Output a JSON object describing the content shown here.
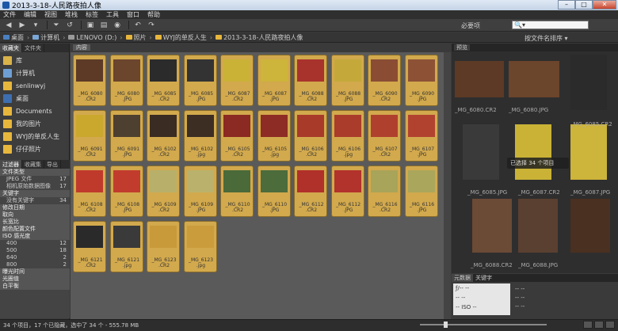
{
  "window": {
    "title": "2013-3-18-人民路夜拍人像",
    "min": "–",
    "max": "□",
    "close": "✕"
  },
  "menu": [
    "文件",
    "编辑",
    "视图",
    "堆栈",
    "标签",
    "工具",
    "窗口",
    "帮助"
  ],
  "toolbar": {
    "workspace": "必要项",
    "search_placeholder": "🔍▾",
    "sort_label": "按文件名排序 ▾"
  },
  "path": [
    "桌面",
    "计算机",
    "LENOVO (D:)",
    "照片",
    "WYJ的单反人生",
    "2013-3-18-人民路夜拍人像"
  ],
  "left": {
    "tabs": [
      "收藏夹",
      "文件夹"
    ],
    "favorites": [
      "库",
      "计算机",
      "senlinwyj",
      "桌面",
      "Documents",
      "我的图片",
      "WYJ的单反人生",
      "仔仔照片"
    ],
    "filter_tabs": [
      "过滤器",
      "收藏集",
      "导出"
    ],
    "filters": [
      {
        "label": "文件类型",
        "count": "",
        "type": "header"
      },
      {
        "label": "JPEG 文件",
        "count": "17",
        "type": "sub"
      },
      {
        "label": "相机原始数据图像",
        "count": "17",
        "type": "sub"
      },
      {
        "label": "关键字",
        "count": "",
        "type": "header"
      },
      {
        "label": "没有关键字",
        "count": "34",
        "type": "sub"
      },
      {
        "label": "修改日期",
        "count": "",
        "type": "header"
      },
      {
        "label": "取向",
        "count": "",
        "type": "header"
      },
      {
        "label": "长宽比",
        "count": "",
        "type": "header"
      },
      {
        "label": "颜色配置文件",
        "count": "",
        "type": "header"
      },
      {
        "label": "ISO 感光度",
        "count": "",
        "type": "header"
      },
      {
        "label": "400",
        "count": "12",
        "type": "sub"
      },
      {
        "label": "500",
        "count": "18",
        "type": "sub"
      },
      {
        "label": "640",
        "count": "2",
        "type": "sub"
      },
      {
        "label": "800",
        "count": "2",
        "type": "sub"
      },
      {
        "label": "曝光时间",
        "count": "",
        "type": "header"
      },
      {
        "label": "光圈值",
        "count": "",
        "type": "header"
      },
      {
        "label": "白平衡",
        "count": "",
        "type": "header"
      }
    ]
  },
  "content": {
    "tab": "内容",
    "thumbs": [
      {
        "name": "_MG_6080",
        "ext": ".CR2",
        "color": "#5c3a26"
      },
      {
        "name": "_MG_6080",
        "ext": ".JPG",
        "color": "#6b452c"
      },
      {
        "name": "_MG_6085",
        "ext": ".CR2",
        "color": "#2b2b2b"
      },
      {
        "name": "_MG_6085",
        "ext": ".JPG",
        "color": "#333333"
      },
      {
        "name": "_MG_6087",
        "ext": ".CR2",
        "color": "#c9b236"
      },
      {
        "name": "_MG_6087",
        "ext": ".JPG",
        "color": "#cdb43a"
      },
      {
        "name": "_MG_6088",
        "ext": ".CR2",
        "color": "#a8332c"
      },
      {
        "name": "_MG_6088",
        "ext": ".JPG",
        "color": "#c4a93a"
      },
      {
        "name": "_MG_6090",
        "ext": ".CR2",
        "color": "#8a4d33"
      },
      {
        "name": "_MG_6090",
        "ext": ".JPG",
        "color": "#8d5236"
      },
      {
        "name": "_MG_6091",
        "ext": ".CR2",
        "color": "#caa82e"
      },
      {
        "name": "_MG_6091",
        "ext": ".JPG",
        "color": "#4d4030"
      },
      {
        "name": "_MG_6102",
        "ext": ".CR2",
        "color": "#3a2c22"
      },
      {
        "name": "_MG_6102",
        "ext": ".jpg",
        "color": "#3d2e24"
      },
      {
        "name": "_MG_6105",
        "ext": ".CR2",
        "color": "#8a2a22"
      },
      {
        "name": "_MG_6105",
        "ext": ".jpg",
        "color": "#8d2c24"
      },
      {
        "name": "_MG_6106",
        "ext": ".CR2",
        "color": "#a83a2a"
      },
      {
        "name": "_MG_6106",
        "ext": ".jpg",
        "color": "#aa3c2c"
      },
      {
        "name": "_MG_6107",
        "ext": ".CR2",
        "color": "#b0402e"
      },
      {
        "name": "_MG_6107",
        "ext": ".JPG",
        "color": "#b24230"
      },
      {
        "name": "_MG_6108",
        "ext": ".CR2",
        "color": "#c03a2c"
      },
      {
        "name": "_MG_6108",
        "ext": ".JPG",
        "color": "#c23c2e"
      },
      {
        "name": "_MG_6109",
        "ext": ".CR2",
        "color": "#b8b06a"
      },
      {
        "name": "_MG_6109",
        "ext": ".JPG",
        "color": "#bab26c"
      },
      {
        "name": "_MG_6110",
        "ext": ".CR2",
        "color": "#4a6a3a"
      },
      {
        "name": "_MG_6110",
        "ext": ".JPG",
        "color": "#4c6c3c"
      },
      {
        "name": "_MG_6112",
        "ext": ".CR2",
        "color": "#b0302a"
      },
      {
        "name": "_MG_6112",
        "ext": ".JPG",
        "color": "#b2322c"
      },
      {
        "name": "_MG_6116",
        "ext": ".CR2",
        "color": "#a8a45a"
      },
      {
        "name": "_MG_6116",
        "ext": ".JPG",
        "color": "#aaa65c"
      },
      {
        "name": "_MG_6121",
        "ext": ".CR2",
        "color": "#2a2a2a"
      },
      {
        "name": "_MG_6121",
        "ext": ".jpg",
        "color": "#3a3a3a"
      },
      {
        "name": "_MG_6123",
        "ext": ".CR2",
        "color": "#c99a3a"
      },
      {
        "name": "_MG_6123",
        "ext": ".jpg",
        "color": "#cb9c3c"
      }
    ]
  },
  "preview": {
    "tab": "预览",
    "captions": [
      "_MG_6080.CR2",
      "_MG_6080.JPG",
      "_MG_6085.CR2",
      "_MG_6085.JPG",
      "_MG_6087.CR2",
      "_MG_6087.JPG",
      "_MG_6088.CR2",
      "_MG_6088.JPG"
    ],
    "tooltip": "已选择 34 个项目"
  },
  "meta": {
    "tabs": [
      "元数据",
      "关键字"
    ],
    "box_lines": [
      "ƒ/--    --",
      "--        --",
      "--      ISO --"
    ],
    "right_lines": [
      "--   --",
      "--   --",
      "--   --"
    ]
  },
  "status": {
    "text": "34 个项目，17 个已隐藏，选中了 34 个 - 555.78 MB"
  }
}
